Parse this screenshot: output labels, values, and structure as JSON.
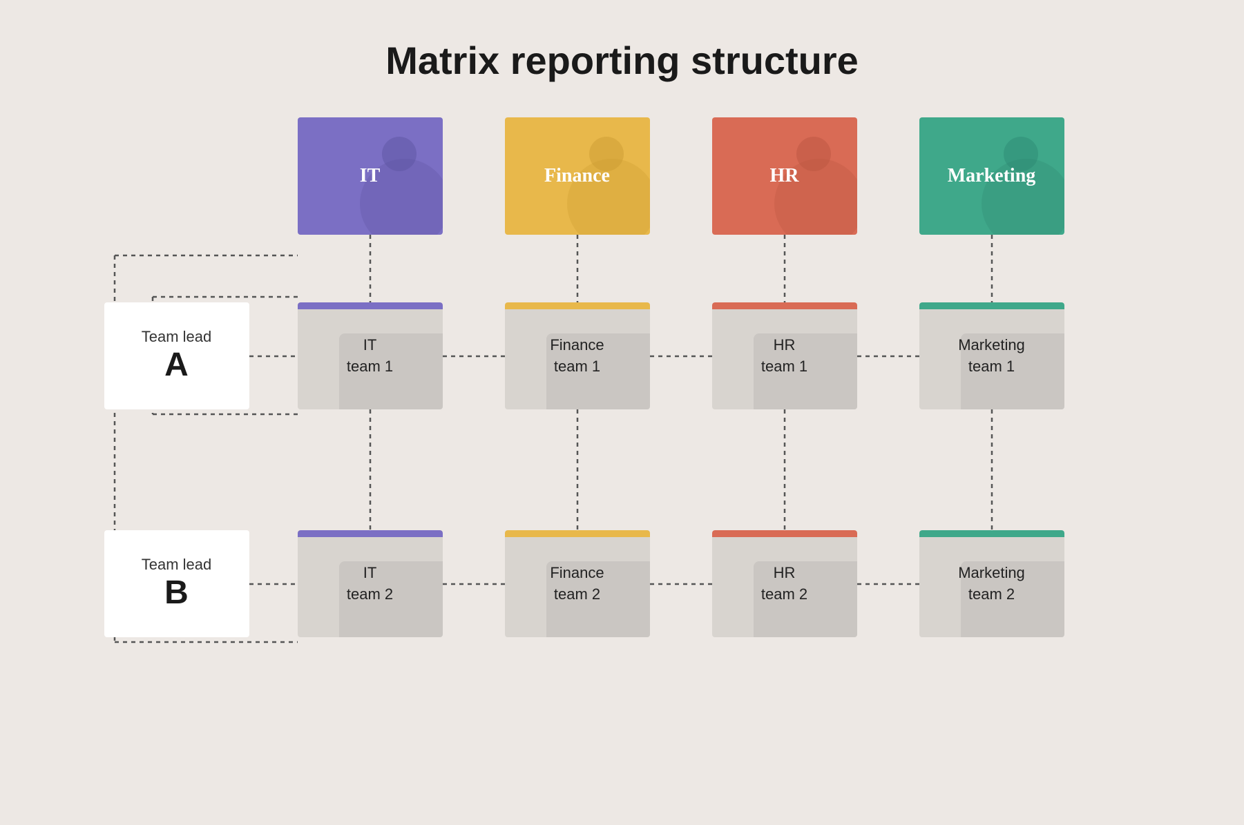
{
  "page": {
    "title": "Matrix reporting structure",
    "background": "#ede8e4"
  },
  "departments": [
    {
      "id": "it",
      "label": "IT",
      "color": "#7b6fc4"
    },
    {
      "id": "finance",
      "label": "Finance",
      "color": "#e8b84b"
    },
    {
      "id": "hr",
      "label": "HR",
      "color": "#d96b55"
    },
    {
      "id": "marketing",
      "label": "Marketing",
      "color": "#3fa88a"
    }
  ],
  "team_leads": [
    {
      "id": "lead-a",
      "label": "Team lead",
      "letter": "A"
    },
    {
      "id": "lead-b",
      "label": "Team lead",
      "letter": "B"
    }
  ],
  "teams": {
    "row1": [
      {
        "id": "it-team-1",
        "line1": "IT",
        "line2": "team 1",
        "bar": "it"
      },
      {
        "id": "finance-team-1",
        "line1": "Finance",
        "line2": "team 1",
        "bar": "finance"
      },
      {
        "id": "hr-team-1",
        "line1": "HR",
        "line2": "team 1",
        "bar": "hr"
      },
      {
        "id": "marketing-team-1",
        "line1": "Marketing",
        "line2": "team 1",
        "bar": "marketing"
      }
    ],
    "row2": [
      {
        "id": "it-team-2",
        "line1": "IT",
        "line2": "team 2",
        "bar": "it"
      },
      {
        "id": "finance-team-2",
        "line1": "Finance",
        "line2": "team 2",
        "bar": "finance"
      },
      {
        "id": "hr-team-2",
        "line1": "HR",
        "line2": "team 2",
        "bar": "hr"
      },
      {
        "id": "marketing-team-2",
        "line1": "Marketing",
        "line2": "team 2",
        "bar": "marketing"
      }
    ]
  }
}
